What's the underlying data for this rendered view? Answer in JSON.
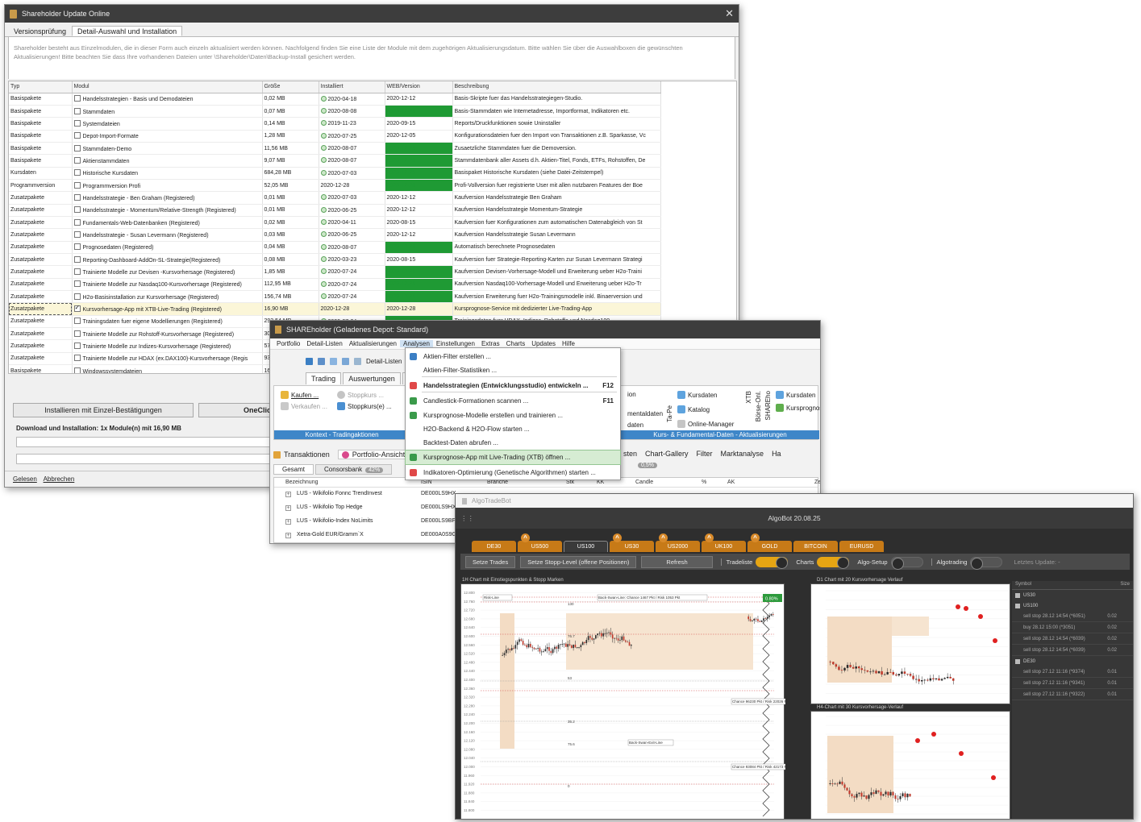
{
  "win1": {
    "title": "Shareholder Update Online",
    "tabs": [
      "Versionsprüfung",
      "Detail-Auswahl und Installation"
    ],
    "info": "Shareholder besteht aus Einzelmodulen, die in dieser Form auch einzeln aktualisiert werden können. Nachfolgend finden Sie eine Liste der Module mit dem zugehörigen Aktualisierungsdatum. Bitte wählen Sie über die Auswahlboxen die gewünschten Aktualisierungen! Bitte beachten Sie dass Ihre vorhandenen Dateien unter \\Shareholder\\Daten\\Backup-Install gesichert werden.",
    "columns": [
      "Typ",
      "Modul",
      "Größe",
      "Installiert",
      "WEB/Version",
      "Beschreibung"
    ],
    "rows": [
      {
        "typ": "Basispakete",
        "modul": "Handelsstrategien - Basis und Demodateien",
        "size": "0,02 MB",
        "inst": "2020-04-18",
        "ok": true,
        "web": "2020-12-12",
        "green": false,
        "desc": "Basis-Skripte fuer das Handelsstrategiegen-Studio.",
        "checked": false
      },
      {
        "typ": "Basispakete",
        "modul": "Stammdaten",
        "size": "0,07 MB",
        "inst": "2020-08-08",
        "ok": true,
        "web": "2020-12-28",
        "green": true,
        "desc": "Basis-Stammdaten wie Internetadresse, Importformat, Indikatoren etc.",
        "checked": false
      },
      {
        "typ": "Basispakete",
        "modul": "Systemdateien",
        "size": "0,14 MB",
        "inst": "2019-11-23",
        "ok": true,
        "web": "2020-09-15",
        "green": false,
        "desc": "Reports/Druckfunktionen sowie Uninstaller",
        "checked": false
      },
      {
        "typ": "Basispakete",
        "modul": "Depot-Import-Formate",
        "size": "1,28 MB",
        "inst": "2020-07-25",
        "ok": true,
        "web": "2020-12-05",
        "green": false,
        "desc": "Konfigurationsdateien fuer den Import von Transaktionen z.B. Sparkasse, Vc",
        "checked": false
      },
      {
        "typ": "Basispakete",
        "modul": "Stammdaten-Demo",
        "size": "11,56 MB",
        "inst": "2020-08-07",
        "ok": true,
        "web": "2020-12-28",
        "green": true,
        "desc": "Zusaetzliche Stammdaten fuer die Demoversion.",
        "checked": false
      },
      {
        "typ": "Basispakete",
        "modul": "Aktienstammdaten",
        "size": "9,07 MB",
        "inst": "2020-08-07",
        "ok": true,
        "web": "2020-12-28",
        "green": true,
        "desc": "Stammdatenbank aller Assets d.h. Aktien-Titel, Fonds, ETFs, Rohstoffen, De",
        "checked": false
      },
      {
        "typ": "Kursdaten",
        "modul": "Historische Kursdaten",
        "size": "684,28 MB",
        "inst": "2020-07-03",
        "ok": true,
        "web": "2020-12-25",
        "green": true,
        "desc": "Basispaket Historische Kursdaten (siehe Datei-Zeitstempel)",
        "checked": false
      },
      {
        "typ": "Programmversion",
        "modul": "Programmversion Profi",
        "size": "52,05 MB",
        "inst": "2020-12-28",
        "ok": false,
        "web": "2020-12-28",
        "green": true,
        "desc": "Profi-Vollversion fuer registrierte User mit allen nutzbaren Features der Boe",
        "checked": false
      },
      {
        "typ": "Zusatzpakete",
        "modul": "Handelsstrategie - Ben Graham (Registered)",
        "size": "0,01 MB",
        "inst": "2020-07-03",
        "ok": true,
        "web": "2020-12-12",
        "green": false,
        "desc": "Kaufversion Handelsstrategie Ben Graham",
        "checked": false
      },
      {
        "typ": "Zusatzpakete",
        "modul": "Handelsstrategie - Momentum/Relative-Strength (Registered)",
        "size": "0,01 MB",
        "inst": "2020-06-25",
        "ok": true,
        "web": "2020-12-12",
        "green": false,
        "desc": "Kaufversion Handelsstrategie Momentum-Strategie",
        "checked": false
      },
      {
        "typ": "Zusatzpakete",
        "modul": "Fundamentals-Web-Datenbanken (Registered)",
        "size": "0,02 MB",
        "inst": "2020-04-11",
        "ok": true,
        "web": "2020-08-15",
        "green": false,
        "desc": "Kaufversion fuer Konfigurationen zum automatischen Datenabgleich von St",
        "checked": false
      },
      {
        "typ": "Zusatzpakete",
        "modul": "Handelsstrategie - Susan Levermann (Registered)",
        "size": "0,03 MB",
        "inst": "2020-06-25",
        "ok": true,
        "web": "2020-12-12",
        "green": false,
        "desc": "Kaufversion Handelsstrategie Susan Levermann",
        "checked": false
      },
      {
        "typ": "Zusatzpakete",
        "modul": "Prognosedaten (Registered)",
        "size": "0,04 MB",
        "inst": "2020-08-07",
        "ok": true,
        "web": "2020-12-28",
        "green": true,
        "desc": "Automatisch berechnete Prognosedaten",
        "checked": false
      },
      {
        "typ": "Zusatzpakete",
        "modul": "Reporting-Dashboard-AddOn-SL-Strategie(Registered)",
        "size": "0,08 MB",
        "inst": "2020-03-23",
        "ok": true,
        "web": "2020-08-15",
        "green": false,
        "desc": "Kaufversion fuer Strategie-Reporting-Karten zur Susan Levermann Strategi",
        "checked": false
      },
      {
        "typ": "Zusatzpakete",
        "modul": "Trainierte Modelle zur Devisen -Kursvorhersage (Registered)",
        "size": "1,85 MB",
        "inst": "2020-07-24",
        "ok": true,
        "web": "2020-12-26",
        "green": true,
        "desc": "Kaufversion Devisen-Vorhersage-Modell und Erweiterung ueber H2o-Traini",
        "checked": false
      },
      {
        "typ": "Zusatzpakete",
        "modul": "Trainierte Modelle zur Nasdaq100-Kursvorhersage (Registered)",
        "size": "112,95 MB",
        "inst": "2020-07-24",
        "ok": true,
        "web": "2020-12-26",
        "green": true,
        "desc": "Kaufversion Nasdaq100-Vorhersage-Modell und Erweiterung ueber H2o-Tr",
        "checked": false
      },
      {
        "typ": "Zusatzpakete",
        "modul": "H2o-Basisinstallation zur Kursvorhersage (Registered)",
        "size": "156,74 MB",
        "inst": "2020-07-24",
        "ok": true,
        "web": "2020-12-26",
        "green": true,
        "desc": "Kaufversion Erweiterung fuer H2o-Trainingsmodelle inkl. Binaerversion und",
        "checked": false
      },
      {
        "typ": "Zusatzpakete",
        "modul": "Kursvorhersage-App mit XTB-Live-Trading (Registered)",
        "size": "16,90 MB",
        "inst": "2020-12-28",
        "ok": false,
        "web": "2020-12-28",
        "green": false,
        "desc": "Kursprognose-Service mit dedizierter Live-Trading-App",
        "checked": true,
        "selected": true
      },
      {
        "typ": "Zusatzpakete",
        "modul": "Trainingsdaten fuer eigene Modellierungen (Registered)",
        "size": "292,54 MB",
        "inst": "2020-07-24",
        "ok": true,
        "web": "2020-12-26",
        "green": true,
        "desc": "Trainingsdaten fuer HDAX, Indizes, Rohstoffe und Nasdaq100",
        "checked": false
      },
      {
        "typ": "Zusatzpakete",
        "modul": "Trainierte Modelle zur Rohstoff-Kursvorhersage (Registered)",
        "size": "30,",
        "inst": "",
        "ok": false,
        "web": "",
        "green": false,
        "desc": "",
        "checked": false
      },
      {
        "typ": "Zusatzpakete",
        "modul": "Trainierte Modelle zur Indizes-Kursvorhersage (Registered)",
        "size": "57,",
        "inst": "",
        "ok": false,
        "web": "",
        "green": false,
        "desc": "",
        "checked": false
      },
      {
        "typ": "Zusatzpakete",
        "modul": "Trainierte Modelle zur HDAX (ex.DAX100)-Kursvorhersage (Regis",
        "size": "93,",
        "inst": "",
        "ok": false,
        "web": "",
        "green": false,
        "desc": "",
        "checked": false
      },
      {
        "typ": "Basispakete",
        "modul": "Windowssystemdateien",
        "size": "16,",
        "inst": "",
        "ok": false,
        "web": "",
        "green": false,
        "desc": "",
        "checked": false
      }
    ],
    "install_button": "Installieren mit Einzel-Bestätigungen",
    "oneclick_button": "OneClick",
    "download_text": "Download und Installation: 1x Module(n) mit 16,90 MB",
    "status": [
      "Gelesen",
      "Abbrechen"
    ]
  },
  "win2": {
    "title": "SHAREholder (Geladenes Depot: Standard)",
    "menu": [
      "Portfolio",
      "Detail-Listen",
      "Aktualisierungen",
      "Analysen",
      "Einstellungen",
      "Extras",
      "Charts",
      "Updates",
      "Hilfe"
    ],
    "toolbar_label": "Detail-Listen",
    "ribbon_tabs": [
      "Trading",
      "Auswertungen",
      "D"
    ],
    "btn_kaufen": "Kaufen ...",
    "btn_stoppkurs": "Stoppkurs ...",
    "btn_verkaufen": "Verkaufen ...",
    "btn_stoppkurse": "Stoppkurs(e) ...",
    "group_trading": "Kontext - Tradingaktionen",
    "right_frag_1": "ion",
    "right_frag_2": "sten",
    "right_frag_3": "mentaldaten",
    "right_frag_4": "daten",
    "btn_kursdaten": "Kursdaten",
    "btn_katalog": "Katalog",
    "btn_online_manager": "Online-Manager",
    "vert_tape": "Ta-Pe",
    "vert_xtb": "XTB",
    "vert_boerse": "Börse-Onl.",
    "vert_shareho": "SHAREho",
    "btn_kursdaten2": "Kursdaten",
    "btn_kursprognose": "Kursprognose",
    "group_kurs": "Kurs- & Fundamental-Daten - Aktualisierungen",
    "tabs2": [
      "Transaktionen",
      "Portfolio-Ansicht"
    ],
    "tabs2_right": [
      "sten",
      "Chart-Gallery",
      "Filter",
      "Marktanalyse",
      "Ha"
    ],
    "sub_tabs": [
      "Gesamt",
      "Consorsbank"
    ],
    "badge1": "42%",
    "badge2": "0,5%",
    "list_cols": [
      "Bezeichnung",
      "ISIN",
      "Branche",
      "Stk",
      "KK",
      "Candle",
      "%",
      "AK",
      "Zeit"
    ],
    "list_rows": [
      {
        "name": "LUS - Wikifolio Fonnc TrendInvest",
        "isin": "DE000LS9HX"
      },
      {
        "name": "LUS - Wikifolio Top Hedge",
        "isin": "DE000LS9HXS"
      },
      {
        "name": "LUS - Wikifolio-Index NoLimits",
        "isin": "DE000LS9BFD"
      },
      {
        "name": "Xetra-Gold EUR/Gramm`X",
        "isin": "DE000A0S9G"
      }
    ]
  },
  "dropdown": {
    "items": [
      {
        "label": "Aktien-Filter erstellen ...",
        "sc": "",
        "bold": false,
        "hl": false
      },
      {
        "label": "Aktien-Filter-Statistiken ...",
        "sc": "",
        "bold": false,
        "hl": false
      },
      {
        "label": "Handelsstrategien (Entwicklungsstudio) entwickeln ...",
        "sc": "F12",
        "bold": true,
        "hl": false
      },
      {
        "label": "Candlestick-Formationen scannen ...",
        "sc": "F11",
        "bold": false,
        "hl": false
      },
      {
        "label": "Kursprognose-Modelle erstellen und trainieren ...",
        "sc": "",
        "bold": false,
        "hl": false
      },
      {
        "label": "H2O-Backend & H2O-Flow starten ...",
        "sc": "",
        "bold": false,
        "hl": false
      },
      {
        "label": "Backtest-Daten abrufen ...",
        "sc": "",
        "bold": false,
        "hl": false
      },
      {
        "label": "Kursprognose-App mit Live-Trading (XTB) öffnen ...",
        "sc": "",
        "bold": false,
        "hl": true
      },
      {
        "label": "Indikatoren-Optimierung (Genetische Algorithmen) starten ...",
        "sc": "",
        "bold": false,
        "hl": false
      }
    ]
  },
  "win3": {
    "title": "AlgoTradeBot",
    "header": "AlgoBot 20.08.25",
    "markets": [
      {
        "label": "DE30",
        "warn": false,
        "active": false
      },
      {
        "label": "US500",
        "warn": true,
        "active": false
      },
      {
        "label": "US100",
        "warn": false,
        "active": true
      },
      {
        "label": "US30",
        "warn": true,
        "active": false
      },
      {
        "label": "US2000",
        "warn": true,
        "active": false
      },
      {
        "label": "UK100",
        "warn": true,
        "active": false
      },
      {
        "label": "GOLD",
        "warn": true,
        "active": false
      },
      {
        "label": "BITCOIN",
        "warn": false,
        "active": false
      },
      {
        "label": "EURUSD",
        "warn": false,
        "active": false
      }
    ],
    "ctrl": {
      "set_trades": "Setze Trades",
      "set_stop": "Setze Stopp-Level (offene Positionen)",
      "refresh": "Refresh",
      "tradeliste": "Tradeliste",
      "charts": "Charts",
      "algo_setup": "Algo-Setup",
      "algotrading": "Algotrading",
      "last_update": "Letztes Update: -"
    },
    "chart1_title": "1H Chart mit Einstiegspunkten & Stopp Marken",
    "chart1_labels": {
      "risk_line": "Risk-Line",
      "chance": "Back-Swan-Line: Chance 1467 Pkt / Risk 1053 Pkt",
      "pct": "0.80%",
      "bs_exit": "Back-Swan-Exit-Line",
      "chance2": "Chance 96230 Pkt / Risk 22026 Pkt",
      "chance3": "Chance 93084 Pkt / Risk 42173 Pkt",
      "l130": "130",
      "l767": "76.7",
      "l53": "53",
      "l352": "35.2",
      "l756": "75.6",
      "l0": "0"
    },
    "chart2_title": "D1 Chart mit 20 Kursvorhersage Verlauf",
    "chart3_title": "H4-Chart mit 30 Kursvorhersage-Verlauf",
    "yticks1": [
      "12.800",
      "12.760",
      "12.720",
      "12.680",
      "12.640",
      "12.600",
      "12.560",
      "12.520",
      "12.480",
      "12.440",
      "12.400",
      "12.360",
      "12.320",
      "12.280",
      "12.240",
      "12.200",
      "12.160",
      "12.120",
      "12.080",
      "12.040",
      "12.000",
      "11.960",
      "11.920",
      "11.880",
      "11.840",
      "11.800"
    ],
    "symbols_header": [
      "Symbol",
      "Size"
    ],
    "groups": [
      {
        "name": "US30",
        "rows": []
      },
      {
        "name": "US100",
        "rows": [
          {
            "t": "sell stop 28.12 14:54 (*6051)",
            "v": "0.02"
          },
          {
            "t": "buy 28.12 15:00 (*3051)",
            "v": "0.02"
          },
          {
            "t": "sell stop 28.12 14:54 (*6039)",
            "v": "0.02"
          },
          {
            "t": "sell stop 28.12 14:54 (*6039)",
            "v": "0.02"
          }
        ]
      },
      {
        "name": "DE30",
        "rows": [
          {
            "t": "sell stop 27.12 11:16 (*9374)",
            "v": "0.01"
          },
          {
            "t": "sell stop 27.12 11:16 (*9341)",
            "v": "0.01"
          },
          {
            "t": "sell stop 27.12 11:16 (*9322)",
            "v": "0.01"
          }
        ]
      }
    ]
  },
  "colors": {
    "green_cell": "#1f9a34",
    "orange_tab": "#c77a17",
    "toggle_on": "#e6a513",
    "menu_highlight": "#d6ecd3",
    "forecast_dot": "#e02020"
  }
}
